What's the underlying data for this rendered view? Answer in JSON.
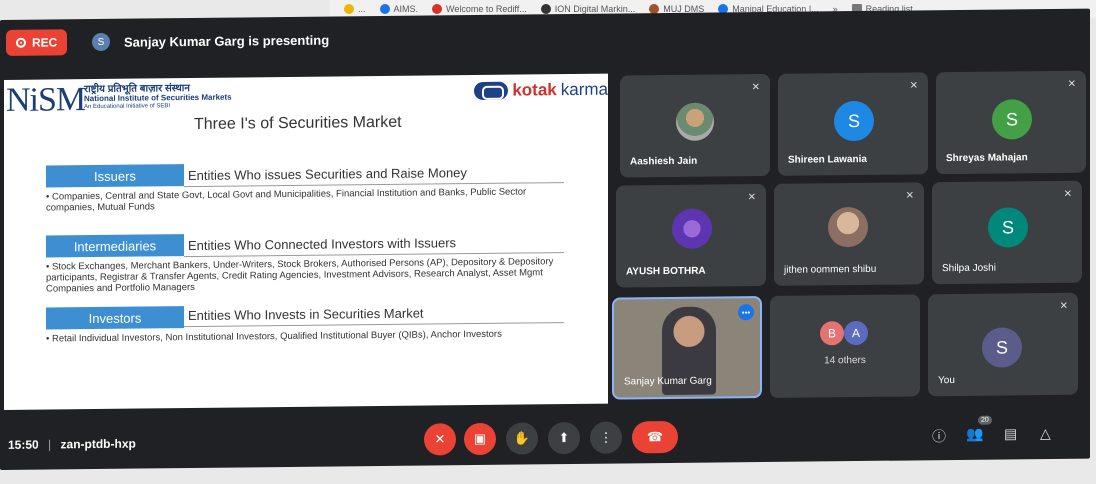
{
  "bookmarks": [
    {
      "label": "...",
      "color": "#f0b400"
    },
    {
      "label": "AIMS.",
      "color": "#1a73e8"
    },
    {
      "label": "Welcome to Rediff...",
      "color": "#d93025"
    },
    {
      "label": "ION Digital Markin...",
      "color": "#333333"
    },
    {
      "label": "MUJ DMS",
      "color": "#a0522d"
    },
    {
      "label": "Manipal Education |...",
      "color": "#1a73e8"
    },
    {
      "label": "»",
      "color": "#f1f1f1"
    },
    {
      "label": "Reading list",
      "color": "#555555"
    }
  ],
  "topbar": {
    "rec_label": "REC",
    "presenter_initial": "S",
    "presenting_text": "Sanjay Kumar Garg is presenting"
  },
  "slide": {
    "logo_text": "NiSM",
    "org_hindi": "राष्ट्रीय प्रतिभूति बाज़ार संस्थान",
    "org_name": "National Institute of Securities Markets",
    "org_tag": "An Educational Initiative of SEBI",
    "kotak": "kotak",
    "karma": "karma",
    "title": "Three I's of Securities Market",
    "categories": [
      {
        "label": "Issuers",
        "desc": "Entities Who issues Securities and Raise Money",
        "bullet": "• Companies, Central and State Govt, Local Govt and Municipalities, Financial Institution and Banks, Public Sector companies, Mutual Funds"
      },
      {
        "label": "Intermediaries",
        "desc": "Entities Who Connected Investors with Issuers",
        "bullet": "• Stock Exchanges, Merchant Bankers, Under-Writers, Stock Brokers, Authorised Persons (AP), Depository & Depository participants, Registrar & Transfer Agents, Credit Rating Agencies, Investment Advisors, Research Analyst, Asset Mgmt Companies and Portfolio Managers"
      },
      {
        "label": "Investors",
        "desc": "Entities Who Invests in Securities Market",
        "bullet": "• Retail Individual Investors, Non Institutional Investors, Qualified Institutional Buyer (QIBs), Anchor Investors"
      }
    ]
  },
  "participants": [
    {
      "name": "Aashiesh Jain",
      "initial": "",
      "color": "#6b8a6f"
    },
    {
      "name": "Shireen Lawania",
      "initial": "S",
      "color": "#1e88e5"
    },
    {
      "name": "Shreyas Mahajan",
      "initial": "S",
      "color": "#43a047"
    },
    {
      "name": "AYUSH BOTHRA",
      "initial": "",
      "color": "#5e35b1"
    },
    {
      "name": "jithen oommen shibu",
      "initial": "",
      "color": "#8d6e63"
    },
    {
      "name": "Shilpa Joshi",
      "initial": "S",
      "color": "#00897b"
    },
    {
      "name": "Sanjay Kumar Garg",
      "initial": "",
      "color": "#7a6a5a"
    },
    {
      "name": "14 others",
      "initial": "B",
      "initial2": "A",
      "color": "#e57373",
      "color2": "#5c6bc0"
    },
    {
      "name": "You",
      "initial": "S",
      "color": "#5c5c8a"
    }
  ],
  "bottom": {
    "time": "15:50",
    "separator": "|",
    "meeting_code": "zan-ptdb-hxp",
    "people_count": "20"
  }
}
